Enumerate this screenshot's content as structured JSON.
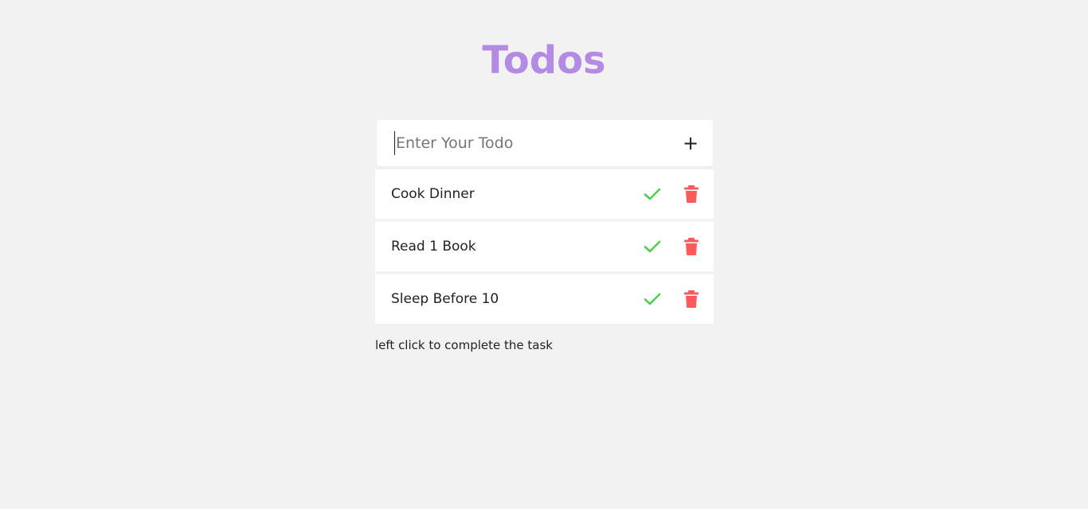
{
  "header": {
    "title": "Todos"
  },
  "input": {
    "placeholder": "Enter Your Todo",
    "value": "",
    "add_label": "+"
  },
  "todos": [
    {
      "text": "Cook Dinner",
      "complete_icon": "check-icon",
      "delete_icon": "trash-icon"
    },
    {
      "text": "Read 1 Book",
      "complete_icon": "check-icon",
      "delete_icon": "trash-icon"
    },
    {
      "text": "Sleep Before 10",
      "complete_icon": "check-icon",
      "delete_icon": "trash-icon"
    }
  ],
  "footer": {
    "hint": "left click to complete the task"
  },
  "colors": {
    "title": "#b48be4",
    "check": "#4cd14c",
    "delete": "#ff5a5a",
    "background": "#f2f2f2"
  }
}
